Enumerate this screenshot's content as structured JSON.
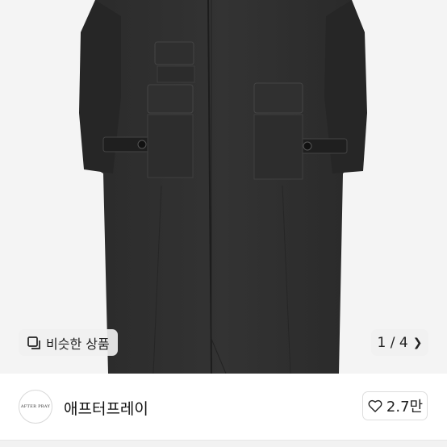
{
  "product": {
    "image_alt": "black long wool coat",
    "similar_label": "비슷한 상품",
    "similar_icon": "similar-items-icon",
    "pager_text": "1 / 4",
    "pager_icon": "chevron-right-icon"
  },
  "seller": {
    "avatar_text": "AFTER PRAY",
    "name": "애프터프레이",
    "likes": "2.7만",
    "like_icon": "heart-outline-icon"
  }
}
